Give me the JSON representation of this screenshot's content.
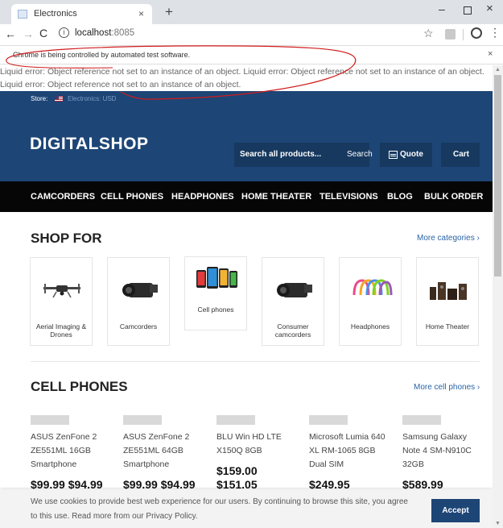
{
  "browser": {
    "tab_title": "Electronics",
    "tab_close": "×",
    "new_tab": "+",
    "win_min": "–",
    "win_close": "×",
    "nav_back": "←",
    "nav_fwd": "→",
    "nav_reload": "C",
    "url_host": "localhost",
    "url_port": ":8085",
    "star": "☆",
    "menu": "⋮",
    "infobar_text": "Chrome is being controlled by automated test software.",
    "infobar_close": "×"
  },
  "error_text": "Liquid error: Object reference not set to an instance of an object. Liquid error: Object reference not set to an instance of an object. Liquid error: Object reference not set to an instance of an object.",
  "store": {
    "label": "Store:",
    "value": "Electronics: USD"
  },
  "header": {
    "logo": "DIGITALSHOP",
    "search_placeholder": "Search all products...",
    "search_button": "Search",
    "quote_label": "Quote",
    "cart_label": "Cart"
  },
  "nav": {
    "items": [
      "CAMCORDERS",
      "CELL PHONES",
      "HEADPHONES",
      "HOME THEATER",
      "TELEVISIONS",
      "BLOG",
      "BULK ORDER"
    ]
  },
  "shop_for": {
    "title": "SHOP FOR",
    "more": "More categories ›",
    "categories": [
      {
        "label": "Aerial Imaging & Drones",
        "icon": "drone-icon"
      },
      {
        "label": "Camcorders",
        "icon": "camcorder-icon"
      },
      {
        "label": "Cell phones",
        "icon": "cell-phones-icon"
      },
      {
        "label": "Consumer camcorders",
        "icon": "camcorder-icon"
      },
      {
        "label": "Headphones",
        "icon": "headphones-icon"
      },
      {
        "label": "Home Theater",
        "icon": "speakers-icon"
      }
    ]
  },
  "cell_phones": {
    "title": "CELL PHONES",
    "more": "More cell phones ›",
    "products": [
      {
        "name": "ASUS ZenFone 2 ZE551ML 16GB Smartphone",
        "price_line1": "",
        "price_line2": "$99.99 $94.99"
      },
      {
        "name": "ASUS ZenFone 2 ZE551ML 64GB Smartphone",
        "price_line1": "",
        "price_line2": "$99.99 $94.99"
      },
      {
        "name": "BLU Win HD LTE X150Q 8GB",
        "price_line1": "$159.00",
        "price_line2": "$151.05"
      },
      {
        "name": "Microsoft Lumia 640 XL RM-1065 8GB Dual SIM",
        "price_line1": "",
        "price_line2": "$249.95"
      },
      {
        "name": "Samsung Galaxy Note 4 SM-N910C 32GB",
        "price_line1": "",
        "price_line2": "$589.99"
      }
    ]
  },
  "cookie": {
    "text": "We use cookies to provide best web experience for our users. By continuing to browse this site, you agree to this use. Read more from our Privacy Policy.",
    "accept": "Accept"
  },
  "colors": {
    "brand_blue": "#1d4576",
    "nav_black": "#060606",
    "link_blue": "#2a64a8",
    "annotation_red": "#d01c1c"
  }
}
